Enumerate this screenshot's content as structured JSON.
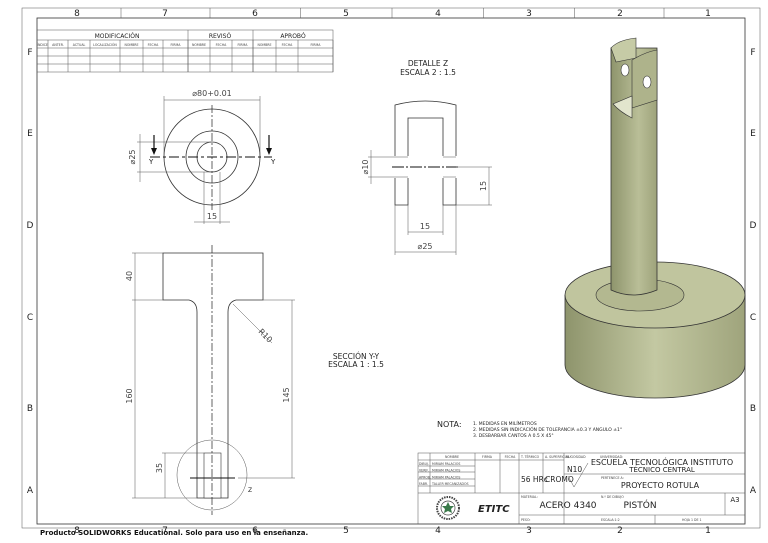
{
  "frame": {
    "columns": [
      "8",
      "7",
      "6",
      "5",
      "4",
      "3",
      "2",
      "1"
    ],
    "rows": [
      "F",
      "E",
      "D",
      "C",
      "B",
      "A"
    ]
  },
  "revision_table": {
    "groups": [
      "MODIFICACIÓN",
      "REVISÓ",
      "APROBÓ"
    ],
    "columns": [
      "ÍNDICE",
      "ANTER.",
      "ACTUAL",
      "LOCALIZACIÓN",
      "NOMBRE",
      "FECHA",
      "FIRMA",
      "NOMBRE",
      "FECHA",
      "FIRMA",
      "NOMBRE",
      "FECHA",
      "FIRMA"
    ]
  },
  "top_view": {
    "dia_outer": "⌀80+0.01",
    "dia_inner": "⌀25",
    "width": "15",
    "section_mark": "Y"
  },
  "section_view": {
    "d_head": "40",
    "d_total": "160",
    "d_stem": "145",
    "d_slot": "35",
    "radius": "R10",
    "detail_mark": "Z",
    "title": "SECCIÓN Y-Y",
    "scale": "ESCALA 1 : 1.5"
  },
  "detail_view": {
    "title": "DETALLE Z",
    "scale": "ESCALA 2 : 1.5",
    "hole": "⌀10",
    "height": "15",
    "inner": "15",
    "outer": "⌀25"
  },
  "notes": {
    "label": "NOTA:",
    "items": [
      "1. MEDIDAS EN MILÍMETROS",
      "2. MEDIDAS SIN INDICACIÓN DE TOLERANCIA ±0.3 Y ANGULO ±1°",
      "3. DESBARBAR CANTOS A 0.5 X 45°"
    ]
  },
  "title_block": {
    "headers": [
      "NOMBRE",
      "FIRMA",
      "FECHA",
      "T. TÉRMICO",
      "A. SUPERFICIAL",
      "RUGOSIDAD",
      "UNIVERSIDAD:"
    ],
    "roles": [
      {
        "role": "DIBUJ.",
        "name": "MIRIAM PALACIOS"
      },
      {
        "role": "VERIF.",
        "name": "MIRIAM PALACIOS"
      },
      {
        "role": "APROB.",
        "name": "MIRIAM PALACIOS"
      },
      {
        "role": "FABR.",
        "name": "TALLER MECANIZADOS"
      }
    ],
    "treatment": "56 HRc",
    "surface": "CROMO",
    "roughness": "N10",
    "university": "ESCUELA TECNOLÓGICA INSTITUTO",
    "university2": "TÉCNICO CENTRAL",
    "project_label": "PERTENECE A:",
    "project": "PROYECTO ROTULA",
    "logo_text": "ETITC",
    "material_label": "MATERIAL:",
    "material": "ACERO 4340",
    "drawing_label": "N.º DE DIBUJO",
    "drawing": "PISTÓN",
    "size": "A3",
    "weight_label": "PESO:",
    "scale_label": "ESCALA:1:2",
    "sheet_label": "HOJA 1 DE 1"
  },
  "watermark": "Producto SOLIDWORKS Educational. Solo para uso en la enseñanza.",
  "colors": {
    "model": "#b8bd95",
    "model_dark": "#8e946c",
    "line": "#333333"
  }
}
